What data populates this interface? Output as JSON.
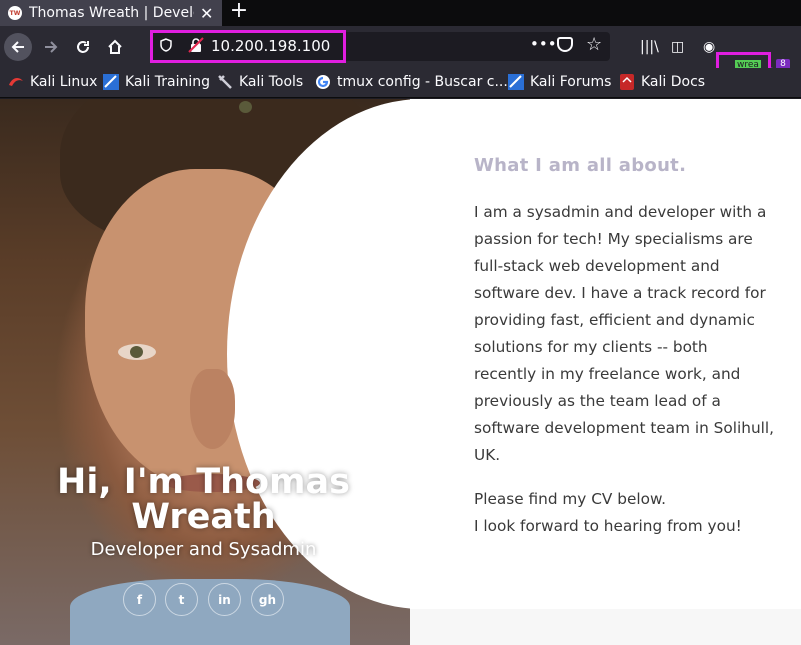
{
  "browser": {
    "tab_title": "Thomas Wreath | Developer",
    "tab_favicon_text": "TW",
    "close_glyph": "✕",
    "new_tab_glyph": "+",
    "url": "10.200.198.100",
    "extension_label": "wrea",
    "extension_badge": "8",
    "highlight_color": "#e01ee0"
  },
  "bookmarks": [
    {
      "label": "Kali Linux",
      "icon": "kali-dragon-icon"
    },
    {
      "label": "Kali Training",
      "icon": "kali-training-icon"
    },
    {
      "label": "Kali Tools",
      "icon": "kali-tools-icon"
    },
    {
      "label": "tmux config - Buscar c...",
      "icon": "google-icon"
    },
    {
      "label": "Kali Forums",
      "icon": "kali-forums-icon"
    },
    {
      "label": "Kali Docs",
      "icon": "kali-docs-icon"
    }
  ],
  "hero": {
    "title": "Hi, I'm Thomas Wreath",
    "subtitle": "Developer and Sysadmin",
    "social": [
      {
        "name": "facebook",
        "glyph": "f"
      },
      {
        "name": "twitter",
        "glyph": "t"
      },
      {
        "name": "linkedin",
        "glyph": "in"
      },
      {
        "name": "github",
        "glyph": "gh"
      }
    ]
  },
  "about": {
    "heading": "What I am all about.",
    "paragraph1": "I am a sysadmin and developer with a passion for tech! My specialisms are full-stack web development and software dev. I have a track record for providing fast, efficient and dynamic solutions for my clients -- both recently in my freelance work, and previously as the team lead of a software development team in Solihull, UK.",
    "line_cv": "Please find my CV below.",
    "line_forward": "I look forward to hearing from you!"
  }
}
